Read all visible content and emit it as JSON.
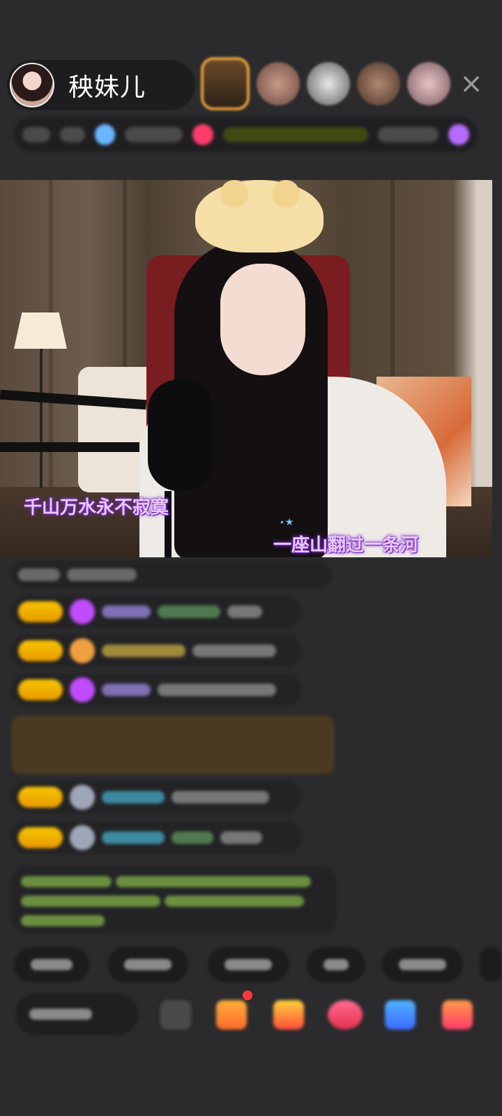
{
  "header": {
    "host_name": "秧妹儿",
    "close_glyph": "×"
  },
  "video": {
    "lyric_line_1": "千山万水永不寂寞",
    "lyric_line_2": "一座山翻过一条河",
    "lyric_decoration": "⋆★"
  },
  "colors": {
    "background": "#2b2b2d",
    "badge": "#f7c400",
    "lyric": "#e9c8ff"
  }
}
